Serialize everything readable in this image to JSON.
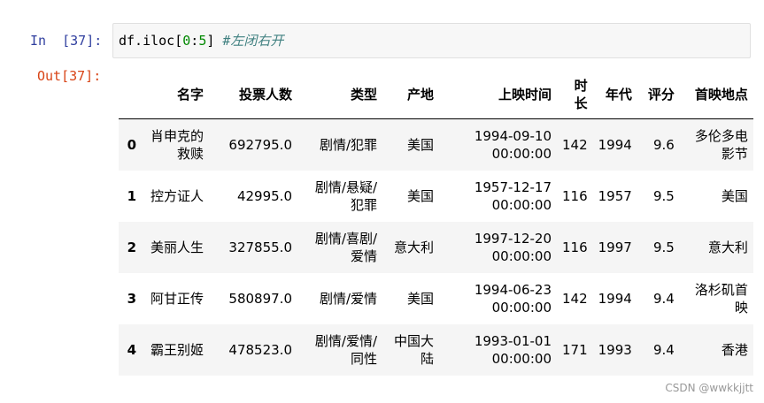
{
  "input": {
    "prompt": "In  [37]:",
    "code": {
      "pre": "df.iloc[",
      "n1": "0",
      "mid": ":",
      "n2": "5",
      "post": "] ",
      "comment": "#左闭右开"
    }
  },
  "output": {
    "prompt": "Out[37]:",
    "columns": [
      "",
      "名字",
      "投票人数",
      "类型",
      "产地",
      "上映时间",
      "时长",
      "年代",
      "评分",
      "首映地点"
    ],
    "rows": [
      {
        "index": "0",
        "cells": [
          "肖申克的救赎",
          "692795.0",
          "剧情/犯罪",
          "美国",
          "1994-09-10 00:00:00",
          "142",
          "1994",
          "9.6",
          "多伦多电影节"
        ]
      },
      {
        "index": "1",
        "cells": [
          "控方证人",
          "42995.0",
          "剧情/悬疑/犯罪",
          "美国",
          "1957-12-17 00:00:00",
          "116",
          "1957",
          "9.5",
          "美国"
        ]
      },
      {
        "index": "2",
        "cells": [
          "美丽人生",
          "327855.0",
          "剧情/喜剧/爱情",
          "意大利",
          "1997-12-20 00:00:00",
          "116",
          "1997",
          "9.5",
          "意大利"
        ]
      },
      {
        "index": "3",
        "cells": [
          "阿甘正传",
          "580897.0",
          "剧情/爱情",
          "美国",
          "1994-06-23 00:00:00",
          "142",
          "1994",
          "9.4",
          "洛杉矶首映"
        ]
      },
      {
        "index": "4",
        "cells": [
          "霸王别姬",
          "478523.0",
          "剧情/爱情/同性",
          "中国大陆",
          "1993-01-01 00:00:00",
          "171",
          "1993",
          "9.4",
          "香港"
        ]
      }
    ]
  },
  "watermark": "CSDN @wwkkjjtt"
}
